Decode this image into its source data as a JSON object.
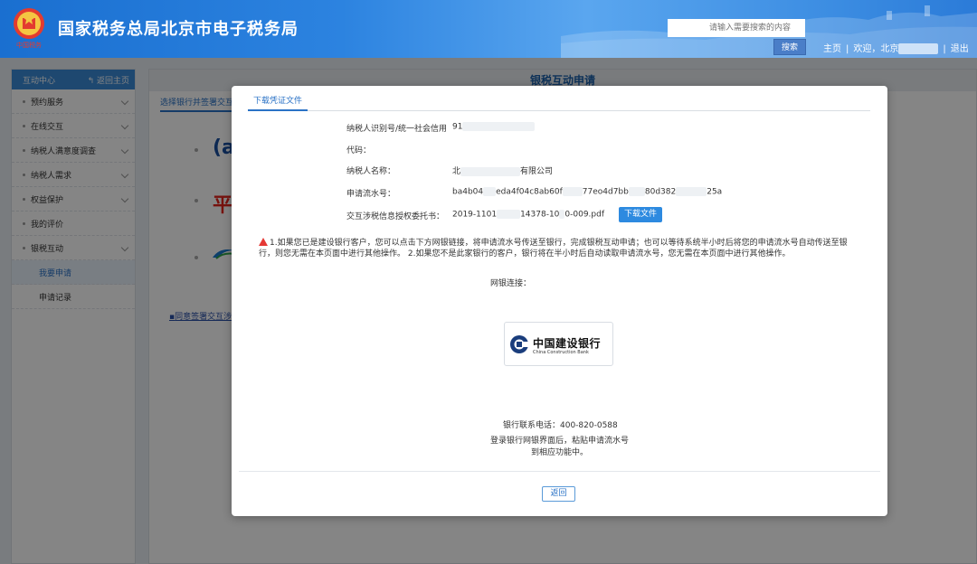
{
  "header": {
    "title": "国家税务总局北京市电子税务局",
    "emblem_caption": "中国税务",
    "search_placeholder": "请输入需要搜索的内容",
    "search_button": "搜索",
    "home_link": "主页",
    "welcome_text": "欢迎，北京",
    "logout_link": "退出"
  },
  "sidebar": {
    "title": "互动中心",
    "back_home": "返回主页",
    "items": [
      {
        "label": "预约服务",
        "expandable": true
      },
      {
        "label": "在线交互",
        "expandable": true
      },
      {
        "label": "纳税人满意度调查",
        "expandable": true
      },
      {
        "label": "纳税人需求",
        "expandable": true
      },
      {
        "label": "权益保护",
        "expandable": true
      },
      {
        "label": "我的评价",
        "expandable": false
      },
      {
        "label": "银税互动",
        "expandable": true
      }
    ],
    "sub_items": [
      {
        "label": "我要申请",
        "active": true
      },
      {
        "label": "申请记录",
        "active": false
      }
    ]
  },
  "main": {
    "title": "银税互动申请",
    "tab_label": "选择银行并签署交互",
    "agreement_link": "同意签署交互涉"
  },
  "modal": {
    "tab_label": "下载凭证文件",
    "fields": {
      "taxpayer_id_label": "纳税人识别号/统一社会信用",
      "taxpayer_id_label2": "代码：",
      "taxpayer_id_value": "91",
      "taxpayer_name_label": "纳税人名称：",
      "taxpayer_name_value_prefix": "北",
      "taxpayer_name_value_suffix": "有限公司",
      "serial_label": "申请流水号：",
      "serial_value_parts": [
        "ba4b04",
        "eda4f04c8ab60f",
        "77e",
        "o4d7bb",
        "",
        "80d382",
        "25a"
      ],
      "authorization_label": "交互涉税信息授权委托书：",
      "authorization_value_prefix": "2019-1101",
      "authorization_value_suffix": "14378-10",
      "authorization_value_tail": "0-009.pdf"
    },
    "download_button": "下载文件",
    "notice": "1.如果您已是建设银行客户，您可以点击下方网银链接，将申请流水号传送至银行，完成银税互动申请；也可以等待系统半小时后将您的申请流水号自动传送至银行，则您无需在本页面中进行其他操作。 2.如果您不是此家银行的客户，银行将在半小时后自动读取申请流水号，您无需在本页面中进行其他操作。",
    "netbank_label": "网银连接：",
    "bank_name_cn": "中国建设银行",
    "bank_name_en": "China Construction Bank",
    "bank_phone": "银行联系电话：400-820-0588",
    "login_tip": "登录银行网银界面后，粘贴申请流水号到相应功能中。",
    "return_button": "返回"
  },
  "colors": {
    "header_blue": "#2c83e0",
    "accent_blue": "#2a72c6",
    "button_blue": "#2d8ae0",
    "warning_red": "#e53935",
    "tax_red": "#e33b2f"
  }
}
